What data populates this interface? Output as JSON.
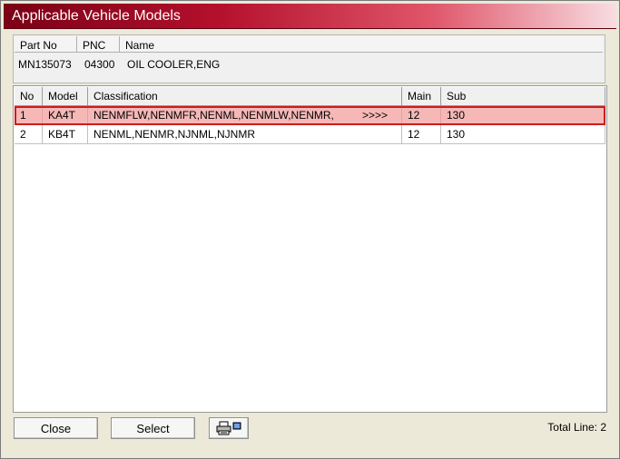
{
  "window": {
    "title": "Applicable Vehicle Models"
  },
  "part_info": {
    "headers": {
      "part_no": "Part No",
      "pnc": "PNC",
      "name": "Name"
    },
    "values": {
      "part_no": "MN135073",
      "pnc": "04300",
      "name": "OIL COOLER,ENG"
    }
  },
  "table": {
    "columns": {
      "no": "No",
      "model": "Model",
      "classification": "Classification",
      "main": "Main",
      "sub": "Sub"
    },
    "rows": [
      {
        "no": "1",
        "model": "KA4T",
        "classification": "NENMFLW,NENMFR,NENML,NENMLW,NENMR,",
        "more": ">>>>",
        "main": "12",
        "sub": "130",
        "selected": true
      },
      {
        "no": "2",
        "model": "KB4T",
        "classification": "NENML,NENMR,NJNML,NJNMR",
        "main": "12",
        "sub": "130",
        "selected": false
      }
    ]
  },
  "buttons": {
    "close": "Close",
    "select": "Select",
    "print_icon": "printer-icon"
  },
  "status": {
    "total_line": "Total Line: 2"
  },
  "colors": {
    "title_start": "#7a0016",
    "selection_fill": "#f6b7b7",
    "selection_border": "#cc1c1c"
  }
}
